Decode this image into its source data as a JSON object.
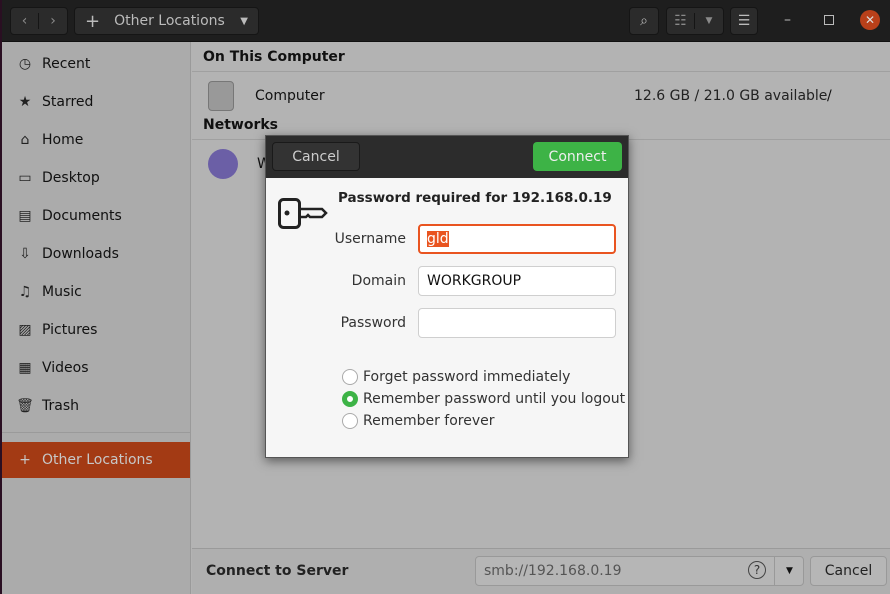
{
  "header": {
    "location": "Other Locations"
  },
  "sidebar": {
    "items": [
      {
        "label": "Recent",
        "icon": "clock-icon"
      },
      {
        "label": "Starred",
        "icon": "star-icon"
      },
      {
        "label": "Home",
        "icon": "home-icon"
      },
      {
        "label": "Desktop",
        "icon": "desktop-icon"
      },
      {
        "label": "Documents",
        "icon": "document-icon"
      },
      {
        "label": "Downloads",
        "icon": "download-icon"
      },
      {
        "label": "Music",
        "icon": "music-icon"
      },
      {
        "label": "Pictures",
        "icon": "picture-icon"
      },
      {
        "label": "Videos",
        "icon": "video-icon"
      },
      {
        "label": "Trash",
        "icon": "trash-icon"
      }
    ],
    "other": "Other Locations",
    "accent": "#a33a14"
  },
  "main": {
    "on_this_computer": "On This Computer",
    "computer": {
      "name": "Computer",
      "space": "12.6 GB / 21.0 GB available",
      "mount": "/"
    },
    "networks": "Networks",
    "network_item": "W"
  },
  "bottom": {
    "label": "Connect to Server",
    "address": "smb://192.168.0.19",
    "cancel": "Cancel"
  },
  "dialog": {
    "cancel": "Cancel",
    "connect": "Connect",
    "title": "Password required for 192.168.0.19",
    "username_label": "Username",
    "username": "gld",
    "domain_label": "Domain",
    "domain": "WORKGROUP",
    "password_label": "Password",
    "password": "",
    "options": [
      "Forget password immediately",
      "Remember password until you logout",
      "Remember forever"
    ],
    "selected_option": 1,
    "connect_color": "#3db346"
  }
}
